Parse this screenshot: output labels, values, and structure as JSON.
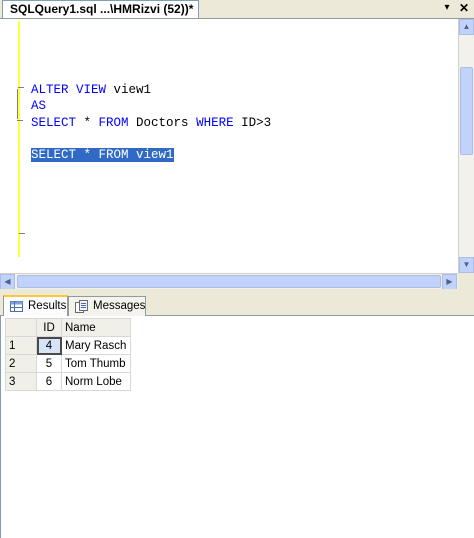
{
  "document_tab": {
    "title": "SQLQuery1.sql ...\\HMRizvi (52))*",
    "dropdown_glyph": "▾",
    "close_glyph": "✕"
  },
  "editor": {
    "lines": [
      {
        "kw1": "ALTER VIEW",
        "rest": " view1"
      },
      {
        "kw1": "AS",
        "rest": ""
      },
      {
        "kw1": "SELECT",
        "mid1": " * ",
        "kw2": "FROM",
        "mid2": " Doctors ",
        "kw3": "WHERE",
        "rest": " ID>3"
      }
    ],
    "selected_line": "SELECT * FROM view1"
  },
  "results_tabs": [
    {
      "label": "Results",
      "icon": "grid-icon",
      "active": true
    },
    {
      "label": "Messages",
      "icon": "messages-icon",
      "active": false
    }
  ],
  "results_grid": {
    "columns": [
      "ID",
      "Name"
    ],
    "rows": [
      {
        "row": "1",
        "id": "4",
        "name": "Mary Rasch"
      },
      {
        "row": "2",
        "id": "5",
        "name": "Tom Thumb"
      },
      {
        "row": "3",
        "id": "6",
        "name": "Norm Lobe"
      }
    ]
  },
  "colors": {
    "keyword": "#0000ff",
    "selection": "#316ac5",
    "change_margin": "#ffff40",
    "active_tab_accent": "#ffc83c"
  }
}
